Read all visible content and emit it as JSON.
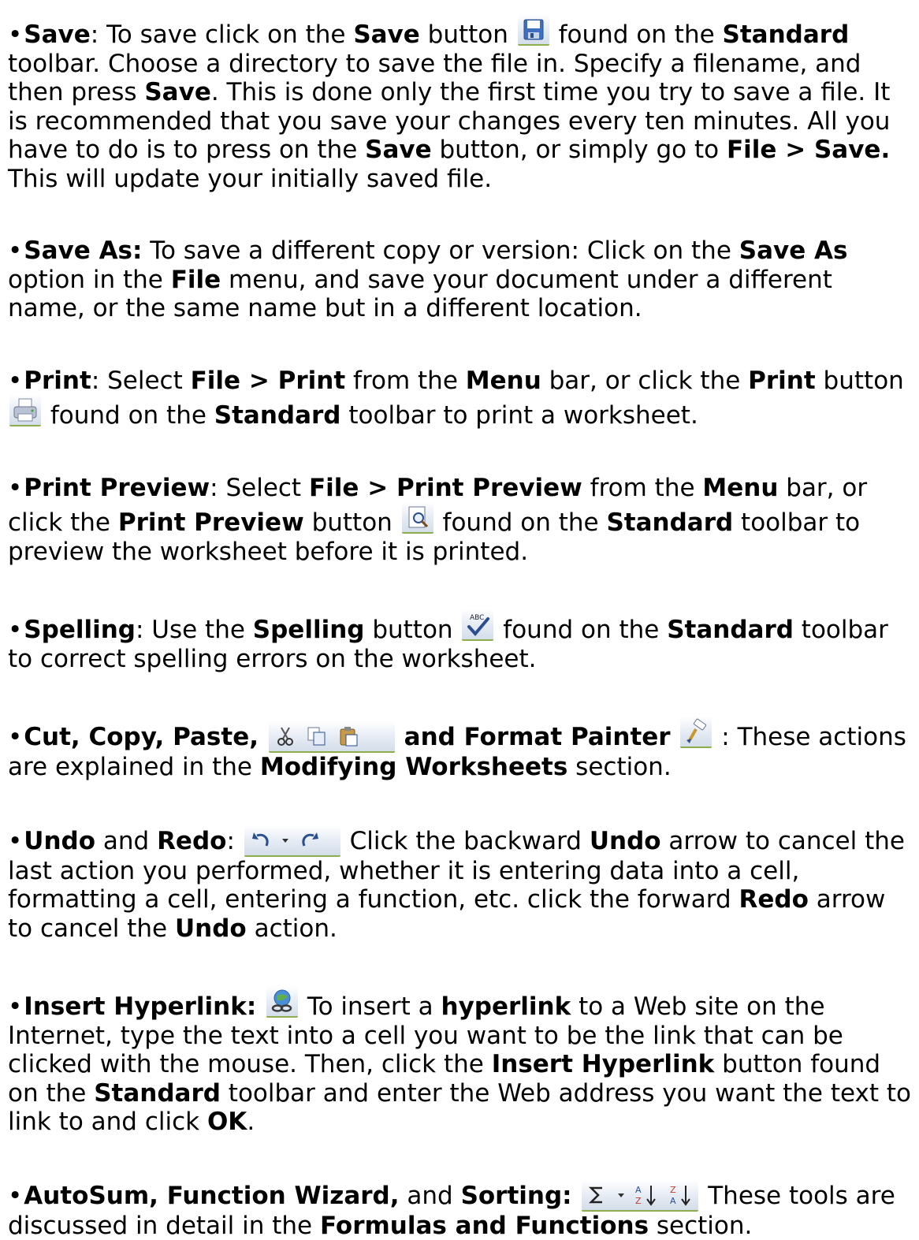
{
  "items": [
    {
      "id": "save",
      "segments": [
        {
          "b": "Save"
        },
        {
          "t": ": To save click on the "
        },
        {
          "b": "Save"
        },
        {
          "t": " button "
        },
        {
          "icon": "save-icon"
        },
        {
          "t": " found on the "
        },
        {
          "b": "Standard"
        },
        {
          "t": " toolbar. Choose a directory to save the file in. Specify a filename, and then press "
        },
        {
          "b": "Save"
        },
        {
          "t": ". This is done only the first time you try to save a file. It is recommended that you save your changes every ten minutes. All you have to do is to press on the "
        },
        {
          "b": "Save"
        },
        {
          "t": " button, or simply go to "
        },
        {
          "b": "File > Save."
        },
        {
          "t": " This will update your initially saved file."
        }
      ]
    },
    {
      "id": "save-as",
      "segments": [
        {
          "b": "Save As:"
        },
        {
          "t": " To save a different copy or version: Click on the "
        },
        {
          "b": "Save As"
        },
        {
          "t": " option in the "
        },
        {
          "b": "File"
        },
        {
          "t": " menu, and save your document under a different name, or the same name but in a different location."
        }
      ]
    },
    {
      "id": "print",
      "segments": [
        {
          "b": "Print"
        },
        {
          "t": ": Select "
        },
        {
          "b": "File > Print"
        },
        {
          "t": " from the "
        },
        {
          "b": "Menu"
        },
        {
          "t": " bar, or click the "
        },
        {
          "b": "Print"
        },
        {
          "t": " button "
        },
        {
          "icon": "print-icon"
        },
        {
          "t": " found on the "
        },
        {
          "b": "Standard"
        },
        {
          "t": " toolbar to print a worksheet."
        }
      ]
    },
    {
      "id": "print-preview",
      "segments": [
        {
          "b": "Print Preview"
        },
        {
          "t": ": Select "
        },
        {
          "b": "File > Print Preview"
        },
        {
          "t": " from the "
        },
        {
          "b": "Menu"
        },
        {
          "t": " bar, or click the "
        },
        {
          "b": "Print Preview"
        },
        {
          "t": " button "
        },
        {
          "icon": "print-preview-icon"
        },
        {
          "t": " found on the "
        },
        {
          "b": "Standard"
        },
        {
          "t": " toolbar to preview the worksheet before it is printed."
        }
      ]
    },
    {
      "id": "spelling",
      "segments": [
        {
          "b": "Spelling"
        },
        {
          "t": ": Use the "
        },
        {
          "b": "Spelling"
        },
        {
          "t": " button "
        },
        {
          "icon": "spelling-icon"
        },
        {
          "t": " found on the "
        },
        {
          "b": "Standard"
        },
        {
          "t": " toolbar to correct spelling errors on the worksheet."
        }
      ]
    },
    {
      "id": "cut-copy-paste",
      "segments": [
        {
          "b": "Cut, Copy, Paste, "
        },
        {
          "icon": "cut-copy-paste-icons"
        },
        {
          "b": " and Format Painter "
        },
        {
          "icon": "format-painter-icon"
        },
        {
          "t": " : These actions are explained in the "
        },
        {
          "b": "Modifying Worksheets"
        },
        {
          "t": " section."
        }
      ]
    },
    {
      "id": "undo-redo",
      "segments": [
        {
          "b": "Undo"
        },
        {
          "t": " and "
        },
        {
          "b": "Redo"
        },
        {
          "t": ": "
        },
        {
          "icon": "undo-redo-icons"
        },
        {
          "t": " Click the backward "
        },
        {
          "b": "Undo"
        },
        {
          "t": " arrow to cancel the last action you performed, whether it is entering data into a cell, formatting a cell, entering a function, etc. click the forward "
        },
        {
          "b": "Redo"
        },
        {
          "t": " arrow to cancel the "
        },
        {
          "b": "Undo"
        },
        {
          "t": " action."
        }
      ]
    },
    {
      "id": "insert-hyperlink",
      "segments": [
        {
          "b": "Insert Hyperlink: "
        },
        {
          "icon": "hyperlink-icon"
        },
        {
          "t": " To insert a "
        },
        {
          "b": "hyperlink"
        },
        {
          "t": " to a Web site on the Internet, type the text into a cell you want to be the link that can be clicked with the mouse. Then, click the "
        },
        {
          "b": "Insert Hyperlink"
        },
        {
          "t": " button found on the "
        },
        {
          "b": "Standard"
        },
        {
          "t": " toolbar and enter the Web address you want the text to link to and click "
        },
        {
          "b": "OK"
        },
        {
          "t": "."
        }
      ]
    },
    {
      "id": "autosum",
      "segments": [
        {
          "b": "AutoSum, Function Wizard,"
        },
        {
          "t": " and "
        },
        {
          "b": "Sorting: "
        },
        {
          "icon": "autosum-sort-icons"
        },
        {
          "t": " These tools are discussed in detail in the "
        },
        {
          "b": "Formulas and Functions"
        },
        {
          "t": " section."
        }
      ]
    }
  ],
  "bullet_char": "•"
}
